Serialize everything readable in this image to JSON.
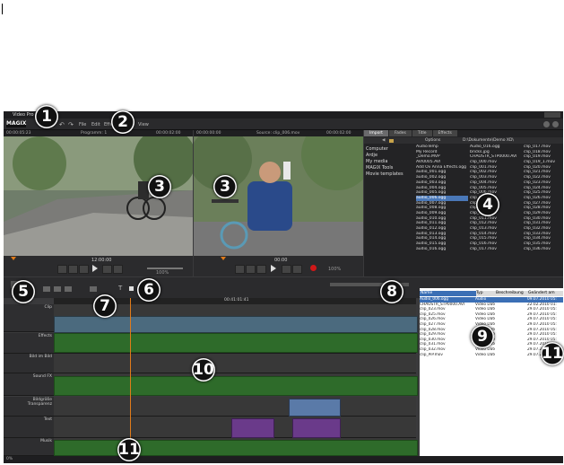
{
  "app": {
    "title": "Video Pro X",
    "logo": "MAGIX",
    "menus": [
      "File",
      "Edit",
      "Effects",
      "View"
    ],
    "accent": "#4a78b8"
  },
  "monitors": {
    "program": {
      "timecode_left": "00:00:05:23",
      "label": "Programm: 1",
      "timecode_right": "00:00:02:00",
      "position": "12:00:00",
      "zoom": "100%"
    },
    "source": {
      "timecode_left": "00:00:00:00",
      "label": "Source: clip_006.mov",
      "timecode_right": "00:00:02:00",
      "position": "00:00",
      "zoom": "100%"
    }
  },
  "media_pool": {
    "tabs": [
      "Import",
      "Fades",
      "Title",
      "Effects"
    ],
    "active_tab": "Import",
    "toolbar": {
      "options": "Options",
      "path": "D:\\Dokumente\\Demo XD\\"
    },
    "nav": [
      "Computer",
      "Ardje",
      "My media",
      "MAGIX Tools",
      "Movie templates"
    ],
    "col1": [
      "AudioTemp",
      "My Record",
      "_Demo.MVP",
      "AVI0005.AVI",
      "Add Ov Anna Effects.ogg",
      "audio_001.ogg",
      "audio_002.ogg",
      "audio_003.ogg",
      "audio_004.ogg",
      "audio_005.ogg",
      "audio_006.ogg",
      "audio_007.ogg",
      "audio_008.ogg",
      "audio_009.ogg",
      "audio_010.ogg",
      "audio_011.ogg",
      "audio_012.ogg",
      "audio_013.ogg",
      "audio_014.ogg",
      "audio_015.ogg",
      "audio_016.ogg"
    ],
    "col1_selected": 10,
    "col2": [
      "Audio_016.ogg",
      "bricks.jpg",
      "CHAOSTR_STP0000.AVI",
      "clip_000.mov",
      "clip_001.mov",
      "clip_002.mov",
      "clip_003.mov",
      "clip_004.mov",
      "clip_005.mov",
      "clip_006.mov",
      "clip_007.mov",
      "clip_008.mov",
      "clip_009.mov",
      "clip_010.mov",
      "clip_011.mov",
      "clip_012.mov",
      "clip_013.mov",
      "clip_014.mov",
      "clip_015.mov",
      "clip_016.mov",
      "clip_017.mov"
    ],
    "col3": [
      "clip_017.mov",
      "clip_018.mov",
      "clip_019.mov",
      "clip_019_1.mov",
      "clip_020.mov",
      "clip_021.mov",
      "clip_022.mov",
      "clip_023.mov",
      "clip_024.mov",
      "clip_025.mov",
      "clip_026.mov",
      "clip_027.mov",
      "clip_028.mov",
      "clip_029.mov",
      "clip_030.mov",
      "clip_031.mov",
      "clip_032.mov",
      "clip_033.mov",
      "clip_034.mov",
      "clip_035.mov",
      "clip_036.mov"
    ]
  },
  "timeline": {
    "ruler_time": "00:41:01:41",
    "tracks": [
      "Clip",
      "Effects",
      "Bild im Bild",
      "Sound FX",
      "Bildgröße Transparenz",
      "Text",
      "Musik"
    ]
  },
  "project_window": {
    "columns": [
      "Name",
      "Typ",
      "Beschreibung",
      "Geändert am"
    ],
    "rows": [
      {
        "name": "Audio_006.ogg",
        "type": "Audio",
        "date": "09.07.2010 05:"
      },
      {
        "name": "CHAOSTR_STP0000.AVI",
        "type": "Video Datei",
        "date": "22.02.2010 01:"
      },
      {
        "name": "clip_023.mov",
        "type": "Video Datei",
        "date": "29.07.2010 05:"
      },
      {
        "name": "clip_025.mov",
        "type": "Video Datei",
        "date": "29.07.2010 05:"
      },
      {
        "name": "clip_026.mov",
        "type": "Video Datei",
        "date": "29.07.2010 05:"
      },
      {
        "name": "clip_027.mov",
        "type": "Video Datei",
        "date": "29.07.2010 05:"
      },
      {
        "name": "clip_028.mov",
        "type": "Video Datei",
        "date": "29.07.2010 05:"
      },
      {
        "name": "clip_029.mov",
        "type": "Video Datei",
        "date": "29.07.2010 05:"
      },
      {
        "name": "clip_030.mov",
        "type": "Video Datei",
        "date": "29.07.2010 05:"
      },
      {
        "name": "clip_031.mov",
        "type": "Video Datei",
        "date": "29.07.2010 05:"
      },
      {
        "name": "clip_032.mov",
        "type": "Video Datei",
        "date": "29.07.2010 05:"
      },
      {
        "name": "clip_PiP.mov",
        "type": "Video Datei",
        "date": "29.07.2010 05:"
      }
    ]
  },
  "status_bar": {
    "text": "0%"
  },
  "callouts": [
    "1",
    "2",
    "3",
    "3",
    "4",
    "5",
    "6",
    "7",
    "8",
    "9",
    "10",
    "11",
    "11"
  ]
}
